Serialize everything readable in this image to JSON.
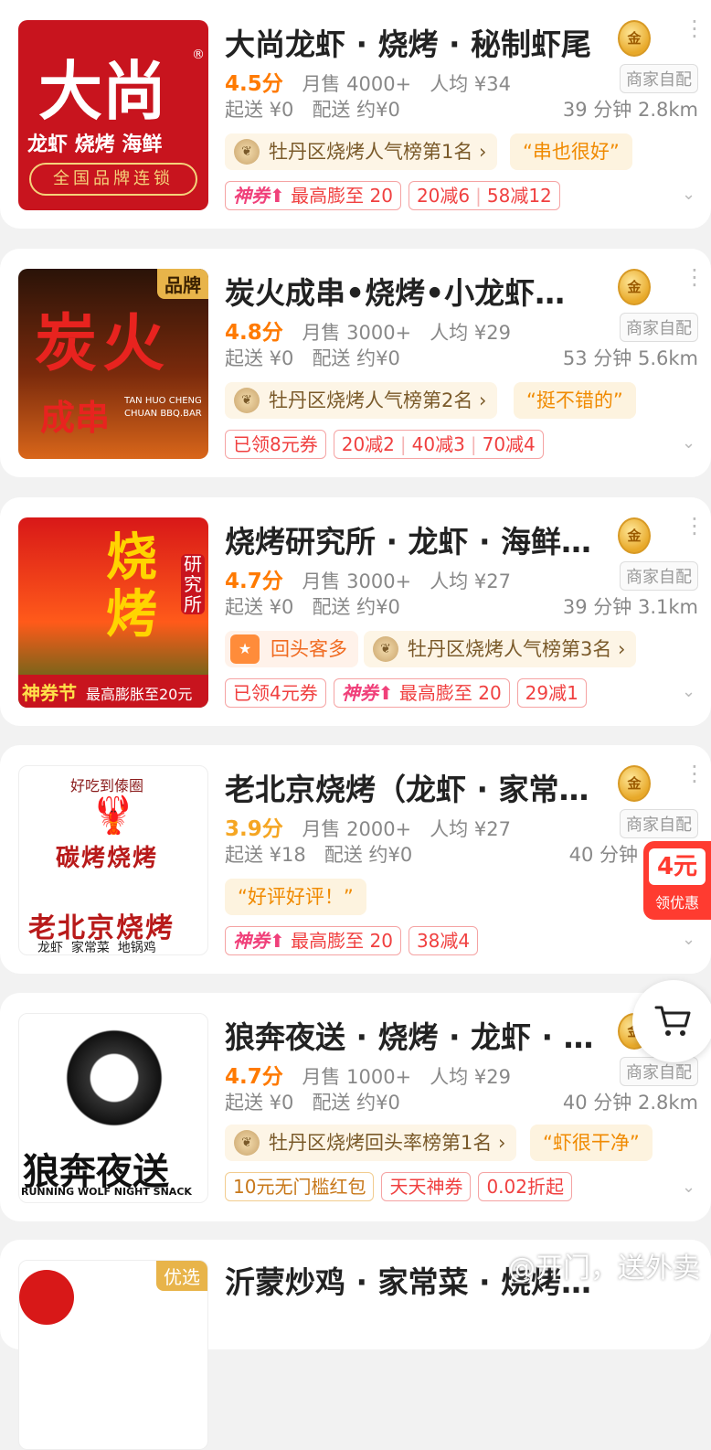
{
  "shops": [
    {
      "title": "大尚龙虾 · 烧烤 · 秘制虾尾",
      "rating": "4.5分",
      "monthly": "月售 4000+",
      "avg": "人均 ¥34",
      "min_order": "起送 ¥0",
      "delivery_fee": "配送 约¥0",
      "time_dist": "39 分钟  2.8km",
      "delivery_type": "商家自配",
      "rank": "牡丹区烧烤人气榜第1名",
      "quote": "“串也很好”",
      "coupons": [
        "最高膨至 20",
        "20减6",
        "58减12"
      ],
      "thumb": {
        "big": "大尚",
        "line2": "龙虾 烧烤 海鲜",
        "line3": "全国品牌连锁",
        "reg": "®"
      }
    },
    {
      "title": "炭火成串•烧烤•小龙虾…",
      "rating": "4.8分",
      "monthly": "月售 3000+",
      "avg": "人均 ¥29",
      "min_order": "起送 ¥0",
      "delivery_fee": "配送 约¥0",
      "time_dist": "53 分钟  5.6km",
      "delivery_type": "商家自配",
      "rank": "牡丹区烧烤人气榜第2名",
      "quote": "“挺不错的”",
      "coupons": [
        "已领8元券",
        "20减2",
        "40减3",
        "70减4"
      ],
      "thumb": {
        "corner": "品牌",
        "big": "炭火",
        "sub": "成串",
        "en": "TAN HUO CHENG CHUAN BBQ.BAR"
      }
    },
    {
      "title": "烧烤研究所 · 龙虾 · 海鲜…",
      "rating": "4.7分",
      "monthly": "月售 3000+",
      "avg": "人均 ¥27",
      "min_order": "起送 ¥0",
      "delivery_fee": "配送 约¥0",
      "time_dist": "39 分钟  3.1km",
      "delivery_type": "商家自配",
      "tag": "回头客多",
      "rank": "牡丹区烧烤人气榜第3名",
      "coupons": [
        "已领4元券",
        "最高膨至 20",
        "29减1"
      ],
      "thumb": {
        "big": "烧烤",
        "side": "研究所",
        "banner1": "神券节",
        "banner2": "最高膨胀至20元"
      }
    },
    {
      "title": "老北京烧烤（龙虾 · 家常…",
      "rating": "3.9分",
      "monthly": "月售 2000+",
      "avg": "人均 ¥27",
      "min_order": "起送 ¥18",
      "delivery_fee": "配送 约¥0",
      "time_dist": "40 分钟",
      "delivery_type": "商家自配",
      "quote": "“好评好评！”",
      "coupons": [
        "最高膨至 20",
        "38减4"
      ],
      "thumb": {
        "arc": "好吃到傣圈",
        "mid": "碳烤烧烤",
        "big": "老北京烧烤",
        "small": "龙虾  家常菜  地锅鸡"
      }
    },
    {
      "title": "狼奔夜送 · 烧烤 · 龙虾 · …",
      "rating": "4.7分",
      "monthly": "月售 1000+",
      "avg": "人均 ¥29",
      "min_order": "起送 ¥0",
      "delivery_fee": "配送 约¥0",
      "time_dist": "40 分钟  2.8km",
      "delivery_type": "商家自配",
      "rank": "牡丹区烧烤回头率榜第1名",
      "quote": "“虾很干净”",
      "coupons": [
        "10元无门槛红包",
        "天天神券",
        "0.02折起"
      ],
      "thumb": {
        "big": "狼奔夜送",
        "en": "RUNNING WOLF NIGHT SNACK"
      }
    },
    {
      "title": "沂蒙炒鸡 · 家常菜 · 烧烤…",
      "thumb": {
        "corner": "优选"
      }
    }
  ],
  "shen_label": "神券",
  "gold_label": "金",
  "float_coupon": {
    "amount": "4元",
    "label": "领优惠"
  },
  "watermark": "@开门，送外卖",
  "colors": {
    "accent": "#ff7a00",
    "coupon": "#f04040",
    "brand_red": "#c8141e"
  }
}
